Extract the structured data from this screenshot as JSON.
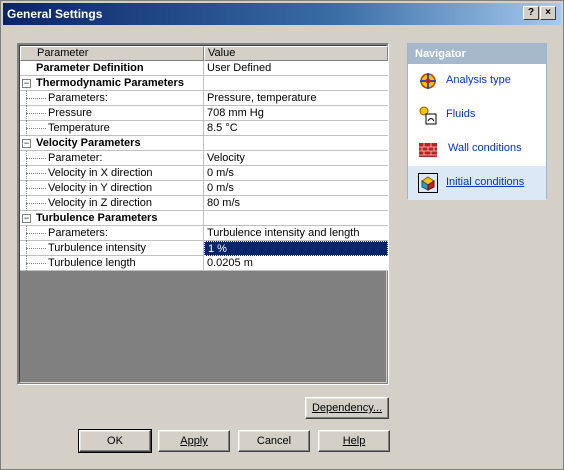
{
  "window": {
    "title": "General Settings",
    "help_btn": "?",
    "close_btn": "×"
  },
  "grid": {
    "columns": [
      "Parameter",
      "Value"
    ],
    "rows": [
      {
        "label": "Parameter Definition",
        "value": "User Defined",
        "kind": "bold"
      },
      {
        "label": "Thermodynamic Parameters",
        "value": "",
        "kind": "group"
      },
      {
        "label": "Parameters:",
        "value": "Pressure, temperature",
        "kind": "child"
      },
      {
        "label": "Pressure",
        "value": "708 mm Hg",
        "kind": "child"
      },
      {
        "label": "Temperature",
        "value": "8.5 °C",
        "kind": "child"
      },
      {
        "label": "Velocity Parameters",
        "value": "",
        "kind": "group"
      },
      {
        "label": "Parameter:",
        "value": "Velocity",
        "kind": "child"
      },
      {
        "label": "Velocity in X direction",
        "value": "0 m/s",
        "kind": "child"
      },
      {
        "label": "Velocity in Y direction",
        "value": "0 m/s",
        "kind": "child"
      },
      {
        "label": "Velocity in Z direction",
        "value": "80 m/s",
        "kind": "child"
      },
      {
        "label": "Turbulence Parameters",
        "value": "",
        "kind": "group"
      },
      {
        "label": "Parameters:",
        "value": "Turbulence intensity and length",
        "kind": "child"
      },
      {
        "label": "Turbulence intensity",
        "value": "1 %",
        "kind": "child-selected"
      },
      {
        "label": "Turbulence length",
        "value": "0.0205 m",
        "kind": "child"
      }
    ]
  },
  "navigator": {
    "title": "Navigator",
    "items": [
      {
        "label": "Analysis type",
        "icon": "analysis-type-icon"
      },
      {
        "label": "Fluids",
        "icon": "fluids-icon"
      },
      {
        "label": "Wall conditions",
        "icon": "wall-conditions-icon"
      },
      {
        "label": "Initial conditions",
        "icon": "initial-conditions-icon",
        "active": true
      }
    ]
  },
  "buttons": {
    "dependency": "Dependency...",
    "ok": "OK",
    "apply": "Apply",
    "cancel": "Cancel",
    "help": "Help"
  }
}
